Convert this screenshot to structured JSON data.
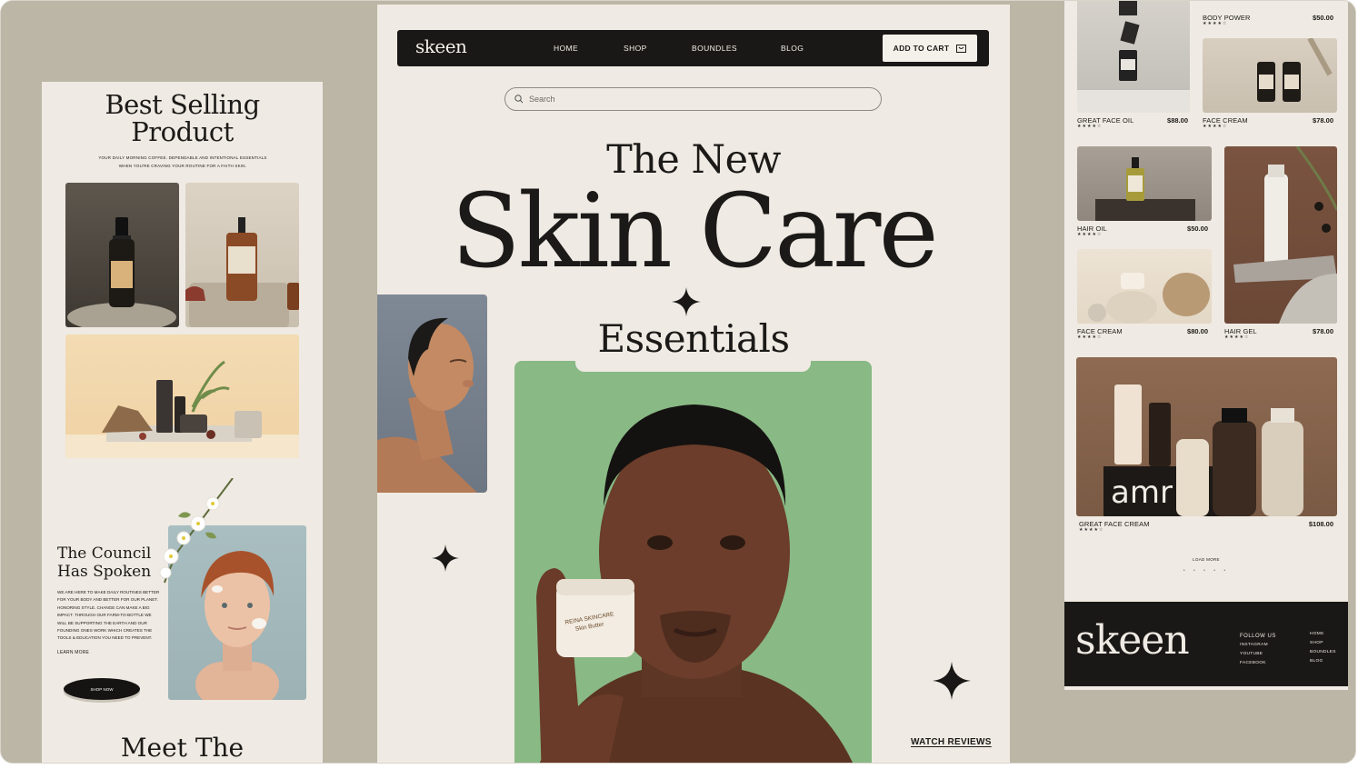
{
  "left": {
    "title_line1": "Best Selling",
    "title_line2": "Product",
    "subtitle_line1": "Your daily morning coffee. Dependable and intentional essentials",
    "subtitle_line2": "when you're craving your routine for a faith skin.",
    "council_line1": "The Council",
    "council_line2": "Has Spoken",
    "council_body": "We are here to make daily routines better for your body and better for our planet. Honoring style. Change can make a big impact. Through our farm-to-bottle we will be supporting the earth and our founding ones work which creates the tools & education you need to prevent.",
    "learn_more": "LEARN MORE",
    "shop_now": "SHOP NOW",
    "meet": "Meet The"
  },
  "center": {
    "brand": "skeen",
    "nav": [
      "HOME",
      "SHOP",
      "BOUNDLES",
      "BLOG"
    ],
    "cart_label": "ADD TO CART",
    "search_placeholder": "Search",
    "hero_line1": "The New",
    "hero_line2": "Skin Care",
    "hero_line3": "Essentials",
    "jar_label1": "REINA SKINCARE",
    "jar_label2": "Skin Butter",
    "watch_reviews": "WATCH REVIEWS"
  },
  "right": {
    "products": [
      {
        "name": "BODY POWER",
        "price": "$50.00",
        "stars": "★★★★☆"
      },
      {
        "name": "GREAT FACE OIL",
        "price": "$88.00",
        "stars": "★★★★☆"
      },
      {
        "name": "FACE CREAM",
        "price": "$78.00",
        "stars": "★★★★☆"
      },
      {
        "name": "HAIR OIL",
        "price": "$50.00",
        "stars": "★★★★☆"
      },
      {
        "name": "FACE CREAM",
        "price": "$80.00",
        "stars": "★★★★☆"
      },
      {
        "name": "HAIR GEL",
        "price": "$78.00",
        "stars": "★★★★☆"
      },
      {
        "name": "GREAT FACE CREAM",
        "price": "$108.00",
        "stars": "★★★★☆"
      }
    ],
    "load_more": "LOAD MORE",
    "pager_dots": "• • • • •",
    "bottle_brand": "amr",
    "footer": {
      "brand": "skeen",
      "follow_title": "FOLLOW US",
      "follow_links": [
        "INSTAGRAM",
        "YOUTUBE",
        "FACEBOOK"
      ],
      "nav_links": [
        "HOME",
        "SHOP",
        "BOUNDLES",
        "BLOG"
      ]
    }
  },
  "colors": {
    "backdrop": "#bbb6a5",
    "page": "#efeae3",
    "dark": "#1a1816",
    "green": "#89b985"
  }
}
